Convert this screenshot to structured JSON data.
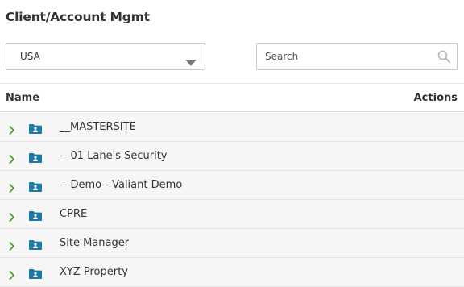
{
  "page": {
    "title": "Client/Account Mgmt"
  },
  "filter": {
    "country_selected": "USA"
  },
  "search": {
    "placeholder": "Search"
  },
  "table": {
    "headers": {
      "name": "Name",
      "actions": "Actions"
    },
    "rows": [
      {
        "name": "__MASTERSITE"
      },
      {
        "name": "-- 01 Lane's Security"
      },
      {
        "name": "-- Demo - Valiant Demo"
      },
      {
        "name": "CPRE"
      },
      {
        "name": "Site Manager"
      },
      {
        "name": "XYZ Property"
      }
    ]
  },
  "icons": {
    "expand": "chevron-right-icon",
    "folder": "folder-user-icon",
    "dropdown": "caret-down-icon",
    "search": "search-icon"
  },
  "colors": {
    "chevron": "#4aa02c",
    "folder": "#1b79a7",
    "row_background": "#f6f6f6",
    "border": "#c9c9c9"
  }
}
